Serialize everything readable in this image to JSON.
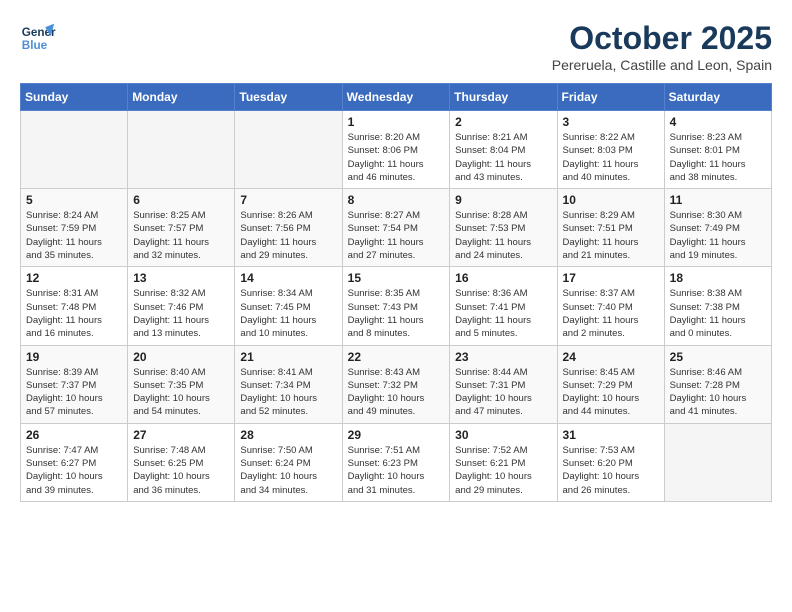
{
  "logo": {
    "line1": "General",
    "line2": "Blue"
  },
  "title": "October 2025",
  "location": "Pereruela, Castille and Leon, Spain",
  "weekdays": [
    "Sunday",
    "Monday",
    "Tuesday",
    "Wednesday",
    "Thursday",
    "Friday",
    "Saturday"
  ],
  "weeks": [
    [
      {
        "day": "",
        "info": ""
      },
      {
        "day": "",
        "info": ""
      },
      {
        "day": "",
        "info": ""
      },
      {
        "day": "1",
        "info": "Sunrise: 8:20 AM\nSunset: 8:06 PM\nDaylight: 11 hours\nand 46 minutes."
      },
      {
        "day": "2",
        "info": "Sunrise: 8:21 AM\nSunset: 8:04 PM\nDaylight: 11 hours\nand 43 minutes."
      },
      {
        "day": "3",
        "info": "Sunrise: 8:22 AM\nSunset: 8:03 PM\nDaylight: 11 hours\nand 40 minutes."
      },
      {
        "day": "4",
        "info": "Sunrise: 8:23 AM\nSunset: 8:01 PM\nDaylight: 11 hours\nand 38 minutes."
      }
    ],
    [
      {
        "day": "5",
        "info": "Sunrise: 8:24 AM\nSunset: 7:59 PM\nDaylight: 11 hours\nand 35 minutes."
      },
      {
        "day": "6",
        "info": "Sunrise: 8:25 AM\nSunset: 7:57 PM\nDaylight: 11 hours\nand 32 minutes."
      },
      {
        "day": "7",
        "info": "Sunrise: 8:26 AM\nSunset: 7:56 PM\nDaylight: 11 hours\nand 29 minutes."
      },
      {
        "day": "8",
        "info": "Sunrise: 8:27 AM\nSunset: 7:54 PM\nDaylight: 11 hours\nand 27 minutes."
      },
      {
        "day": "9",
        "info": "Sunrise: 8:28 AM\nSunset: 7:53 PM\nDaylight: 11 hours\nand 24 minutes."
      },
      {
        "day": "10",
        "info": "Sunrise: 8:29 AM\nSunset: 7:51 PM\nDaylight: 11 hours\nand 21 minutes."
      },
      {
        "day": "11",
        "info": "Sunrise: 8:30 AM\nSunset: 7:49 PM\nDaylight: 11 hours\nand 19 minutes."
      }
    ],
    [
      {
        "day": "12",
        "info": "Sunrise: 8:31 AM\nSunset: 7:48 PM\nDaylight: 11 hours\nand 16 minutes."
      },
      {
        "day": "13",
        "info": "Sunrise: 8:32 AM\nSunset: 7:46 PM\nDaylight: 11 hours\nand 13 minutes."
      },
      {
        "day": "14",
        "info": "Sunrise: 8:34 AM\nSunset: 7:45 PM\nDaylight: 11 hours\nand 10 minutes."
      },
      {
        "day": "15",
        "info": "Sunrise: 8:35 AM\nSunset: 7:43 PM\nDaylight: 11 hours\nand 8 minutes."
      },
      {
        "day": "16",
        "info": "Sunrise: 8:36 AM\nSunset: 7:41 PM\nDaylight: 11 hours\nand 5 minutes."
      },
      {
        "day": "17",
        "info": "Sunrise: 8:37 AM\nSunset: 7:40 PM\nDaylight: 11 hours\nand 2 minutes."
      },
      {
        "day": "18",
        "info": "Sunrise: 8:38 AM\nSunset: 7:38 PM\nDaylight: 11 hours\nand 0 minutes."
      }
    ],
    [
      {
        "day": "19",
        "info": "Sunrise: 8:39 AM\nSunset: 7:37 PM\nDaylight: 10 hours\nand 57 minutes."
      },
      {
        "day": "20",
        "info": "Sunrise: 8:40 AM\nSunset: 7:35 PM\nDaylight: 10 hours\nand 54 minutes."
      },
      {
        "day": "21",
        "info": "Sunrise: 8:41 AM\nSunset: 7:34 PM\nDaylight: 10 hours\nand 52 minutes."
      },
      {
        "day": "22",
        "info": "Sunrise: 8:43 AM\nSunset: 7:32 PM\nDaylight: 10 hours\nand 49 minutes."
      },
      {
        "day": "23",
        "info": "Sunrise: 8:44 AM\nSunset: 7:31 PM\nDaylight: 10 hours\nand 47 minutes."
      },
      {
        "day": "24",
        "info": "Sunrise: 8:45 AM\nSunset: 7:29 PM\nDaylight: 10 hours\nand 44 minutes."
      },
      {
        "day": "25",
        "info": "Sunrise: 8:46 AM\nSunset: 7:28 PM\nDaylight: 10 hours\nand 41 minutes."
      }
    ],
    [
      {
        "day": "26",
        "info": "Sunrise: 7:47 AM\nSunset: 6:27 PM\nDaylight: 10 hours\nand 39 minutes."
      },
      {
        "day": "27",
        "info": "Sunrise: 7:48 AM\nSunset: 6:25 PM\nDaylight: 10 hours\nand 36 minutes."
      },
      {
        "day": "28",
        "info": "Sunrise: 7:50 AM\nSunset: 6:24 PM\nDaylight: 10 hours\nand 34 minutes."
      },
      {
        "day": "29",
        "info": "Sunrise: 7:51 AM\nSunset: 6:23 PM\nDaylight: 10 hours\nand 31 minutes."
      },
      {
        "day": "30",
        "info": "Sunrise: 7:52 AM\nSunset: 6:21 PM\nDaylight: 10 hours\nand 29 minutes."
      },
      {
        "day": "31",
        "info": "Sunrise: 7:53 AM\nSunset: 6:20 PM\nDaylight: 10 hours\nand 26 minutes."
      },
      {
        "day": "",
        "info": ""
      }
    ]
  ]
}
